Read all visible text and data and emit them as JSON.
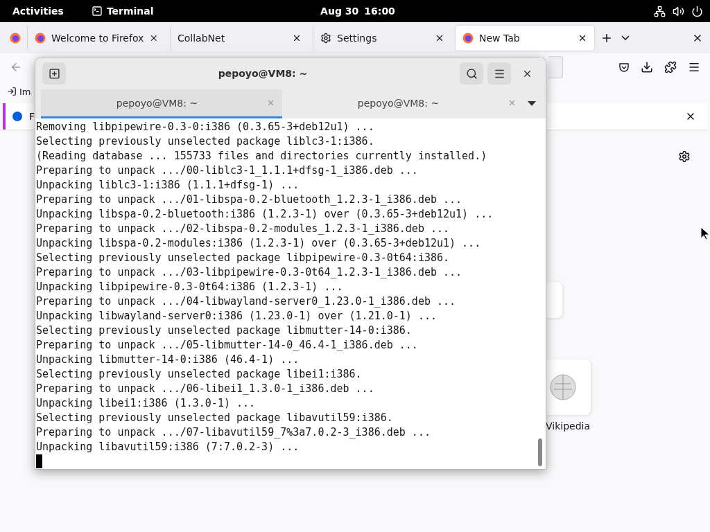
{
  "top_bar": {
    "activities": "Activities",
    "app": "Terminal",
    "date": "Aug 30",
    "time": "16:00"
  },
  "browser": {
    "tabs": [
      {
        "label": "Welcome to Firefox",
        "kind": "firefox",
        "selected": false
      },
      {
        "label": "CollabNet",
        "kind": "plain",
        "selected": false
      },
      {
        "label": "Settings",
        "kind": "settings",
        "selected": false
      },
      {
        "label": "New Tab",
        "kind": "firefox",
        "selected": true
      }
    ],
    "bookmarks": [
      {
        "label": "Im"
      }
    ],
    "notification": {
      "text": "F"
    },
    "shortcuts": [
      {
        "kind": "blank"
      },
      {
        "kind": "wikipedia",
        "label": "Vikipedia"
      }
    ]
  },
  "terminal": {
    "title": "pepoyo@VM8: ~",
    "tabs": [
      {
        "label": "pepoyo@VM8: ~",
        "selected": true
      },
      {
        "label": "pepoyo@VM8: ~",
        "selected": false
      }
    ],
    "lines": [
      "Removing libpipewire-0.3-0:i386 (0.3.65-3+deb12u1) ...",
      "Selecting previously unselected package liblc3-1:i386.",
      "(Reading database ... 155733 files and directories currently installed.)",
      "Preparing to unpack .../00-liblc3-1_1.1.1+dfsg-1_i386.deb ...",
      "Unpacking liblc3-1:i386 (1.1.1+dfsg-1) ...",
      "Preparing to unpack .../01-libspa-0.2-bluetooth_1.2.3-1_i386.deb ...",
      "Unpacking libspa-0.2-bluetooth:i386 (1.2.3-1) over (0.3.65-3+deb12u1) ...",
      "Preparing to unpack .../02-libspa-0.2-modules_1.2.3-1_i386.deb ...",
      "Unpacking libspa-0.2-modules:i386 (1.2.3-1) over (0.3.65-3+deb12u1) ...",
      "Selecting previously unselected package libpipewire-0.3-0t64:i386.",
      "Preparing to unpack .../03-libpipewire-0.3-0t64_1.2.3-1_i386.deb ...",
      "Unpacking libpipewire-0.3-0t64:i386 (1.2.3-1) ...",
      "Preparing to unpack .../04-libwayland-server0_1.23.0-1_i386.deb ...",
      "Unpacking libwayland-server0:i386 (1.23.0-1) over (1.21.0-1) ...",
      "Selecting previously unselected package libmutter-14-0:i386.",
      "Preparing to unpack .../05-libmutter-14-0_46.4-1_i386.deb ...",
      "Unpacking libmutter-14-0:i386 (46.4-1) ...",
      "Selecting previously unselected package libei1:i386.",
      "Preparing to unpack .../06-libei1_1.3.0-1_i386.deb ...",
      "Unpacking libei1:i386 (1.3.0-1) ...",
      "Selecting previously unselected package libavutil59:i386.",
      "Preparing to unpack .../07-libavutil59_7%3a7.0.2-3_i386.deb ...",
      "Unpacking libavutil59:i386 (7:7.0.2-3) ..."
    ]
  }
}
